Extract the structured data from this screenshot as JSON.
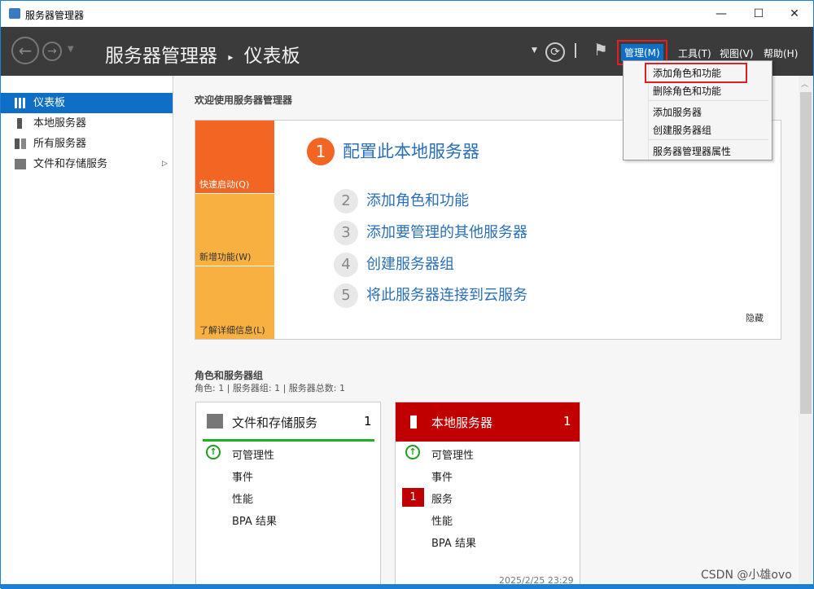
{
  "window": {
    "title": "服务器管理器",
    "minimize": "—",
    "maximize": "☐",
    "close": "✕"
  },
  "header": {
    "breadcrumb_root": "服务器管理器",
    "breadcrumb_sep": "▸",
    "breadcrumb_page": "仪表板",
    "menus": {
      "manage": "管理(M)",
      "tools": "工具(T)",
      "view": "视图(V)",
      "help": "帮助(H)"
    }
  },
  "manage_menu": [
    "添加角色和功能",
    "删除角色和功能",
    "添加服务器",
    "创建服务器组",
    "服务器管理器属性"
  ],
  "sidebar": {
    "items": [
      {
        "label": "仪表板"
      },
      {
        "label": "本地服务器"
      },
      {
        "label": "所有服务器"
      },
      {
        "label": "文件和存储服务"
      }
    ]
  },
  "welcome": {
    "title": "欢迎使用服务器管理器",
    "tiles": [
      "快速启动(Q)",
      "新增功能(W)",
      "了解详细信息(L)"
    ],
    "steps": [
      {
        "n": "1",
        "label": "配置此本地服务器"
      },
      {
        "n": "2",
        "label": "添加角色和功能"
      },
      {
        "n": "3",
        "label": "添加要管理的其他服务器"
      },
      {
        "n": "4",
        "label": "创建服务器组"
      },
      {
        "n": "5",
        "label": "将此服务器连接到云服务"
      }
    ],
    "hide": "隐藏"
  },
  "roles": {
    "title": "角色和服务器组",
    "summary": "角色: 1 | 服务器组: 1 | 服务器总数: 1",
    "cards": [
      {
        "title": "文件和存储服务",
        "count": "1",
        "rows": [
          "可管理性",
          "事件",
          "性能",
          "BPA 结果"
        ]
      },
      {
        "title": "本地服务器",
        "count": "1",
        "rows": [
          "可管理性",
          "事件",
          "服务",
          "性能",
          "BPA 结果"
        ],
        "badge": "1",
        "timestamp": "2025/2/25 23:29"
      }
    ]
  },
  "watermark": "CSDN @小雄ovo",
  "colors": {
    "accent": "#0f6fc6",
    "orange": "#f26522",
    "light_orange": "#f8b040",
    "alert_red": "#c00000",
    "ok_green": "#1ea01e"
  }
}
